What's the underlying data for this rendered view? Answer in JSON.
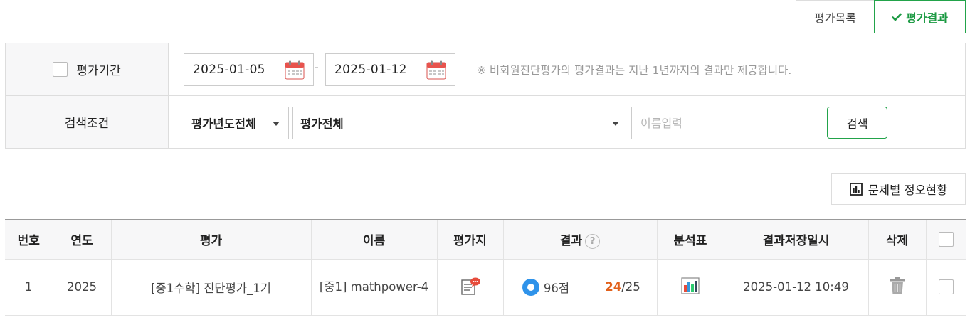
{
  "tabs": {
    "list_label": "평가목록",
    "result_label": "평가결과"
  },
  "filters": {
    "period_label": "평가기간",
    "start_date": "2025-01-05",
    "end_date": "2025-01-12",
    "dash": "-",
    "note": "※ 비회원진단평가의 평가결과는 지난 1년까지의 결과만 제공합니다.",
    "condition_label": "검색조건",
    "year_select": "평가년도전체",
    "eval_select": "평가전체",
    "name_placeholder": "이름입력",
    "search_label": "검색"
  },
  "stats_button_label": "문제별 정오현황",
  "table": {
    "headers": [
      "번호",
      "연도",
      "평가",
      "이름",
      "평가지",
      "결과",
      "분석표",
      "결과저장일시",
      "삭제"
    ],
    "help_symbol": "?",
    "rows": [
      {
        "no": "1",
        "year": "2025",
        "eval": "[중1수학] 진단평가_1기",
        "name": "[중1] mathpower-4",
        "score": "96점",
        "correct": "24",
        "total": "/25",
        "saved_at": "2025-01-12 10:49"
      }
    ]
  },
  "colors": {
    "accent_green": "#22a34a",
    "score_blue": "#2f93ea",
    "correct_orange": "#e2611b"
  }
}
